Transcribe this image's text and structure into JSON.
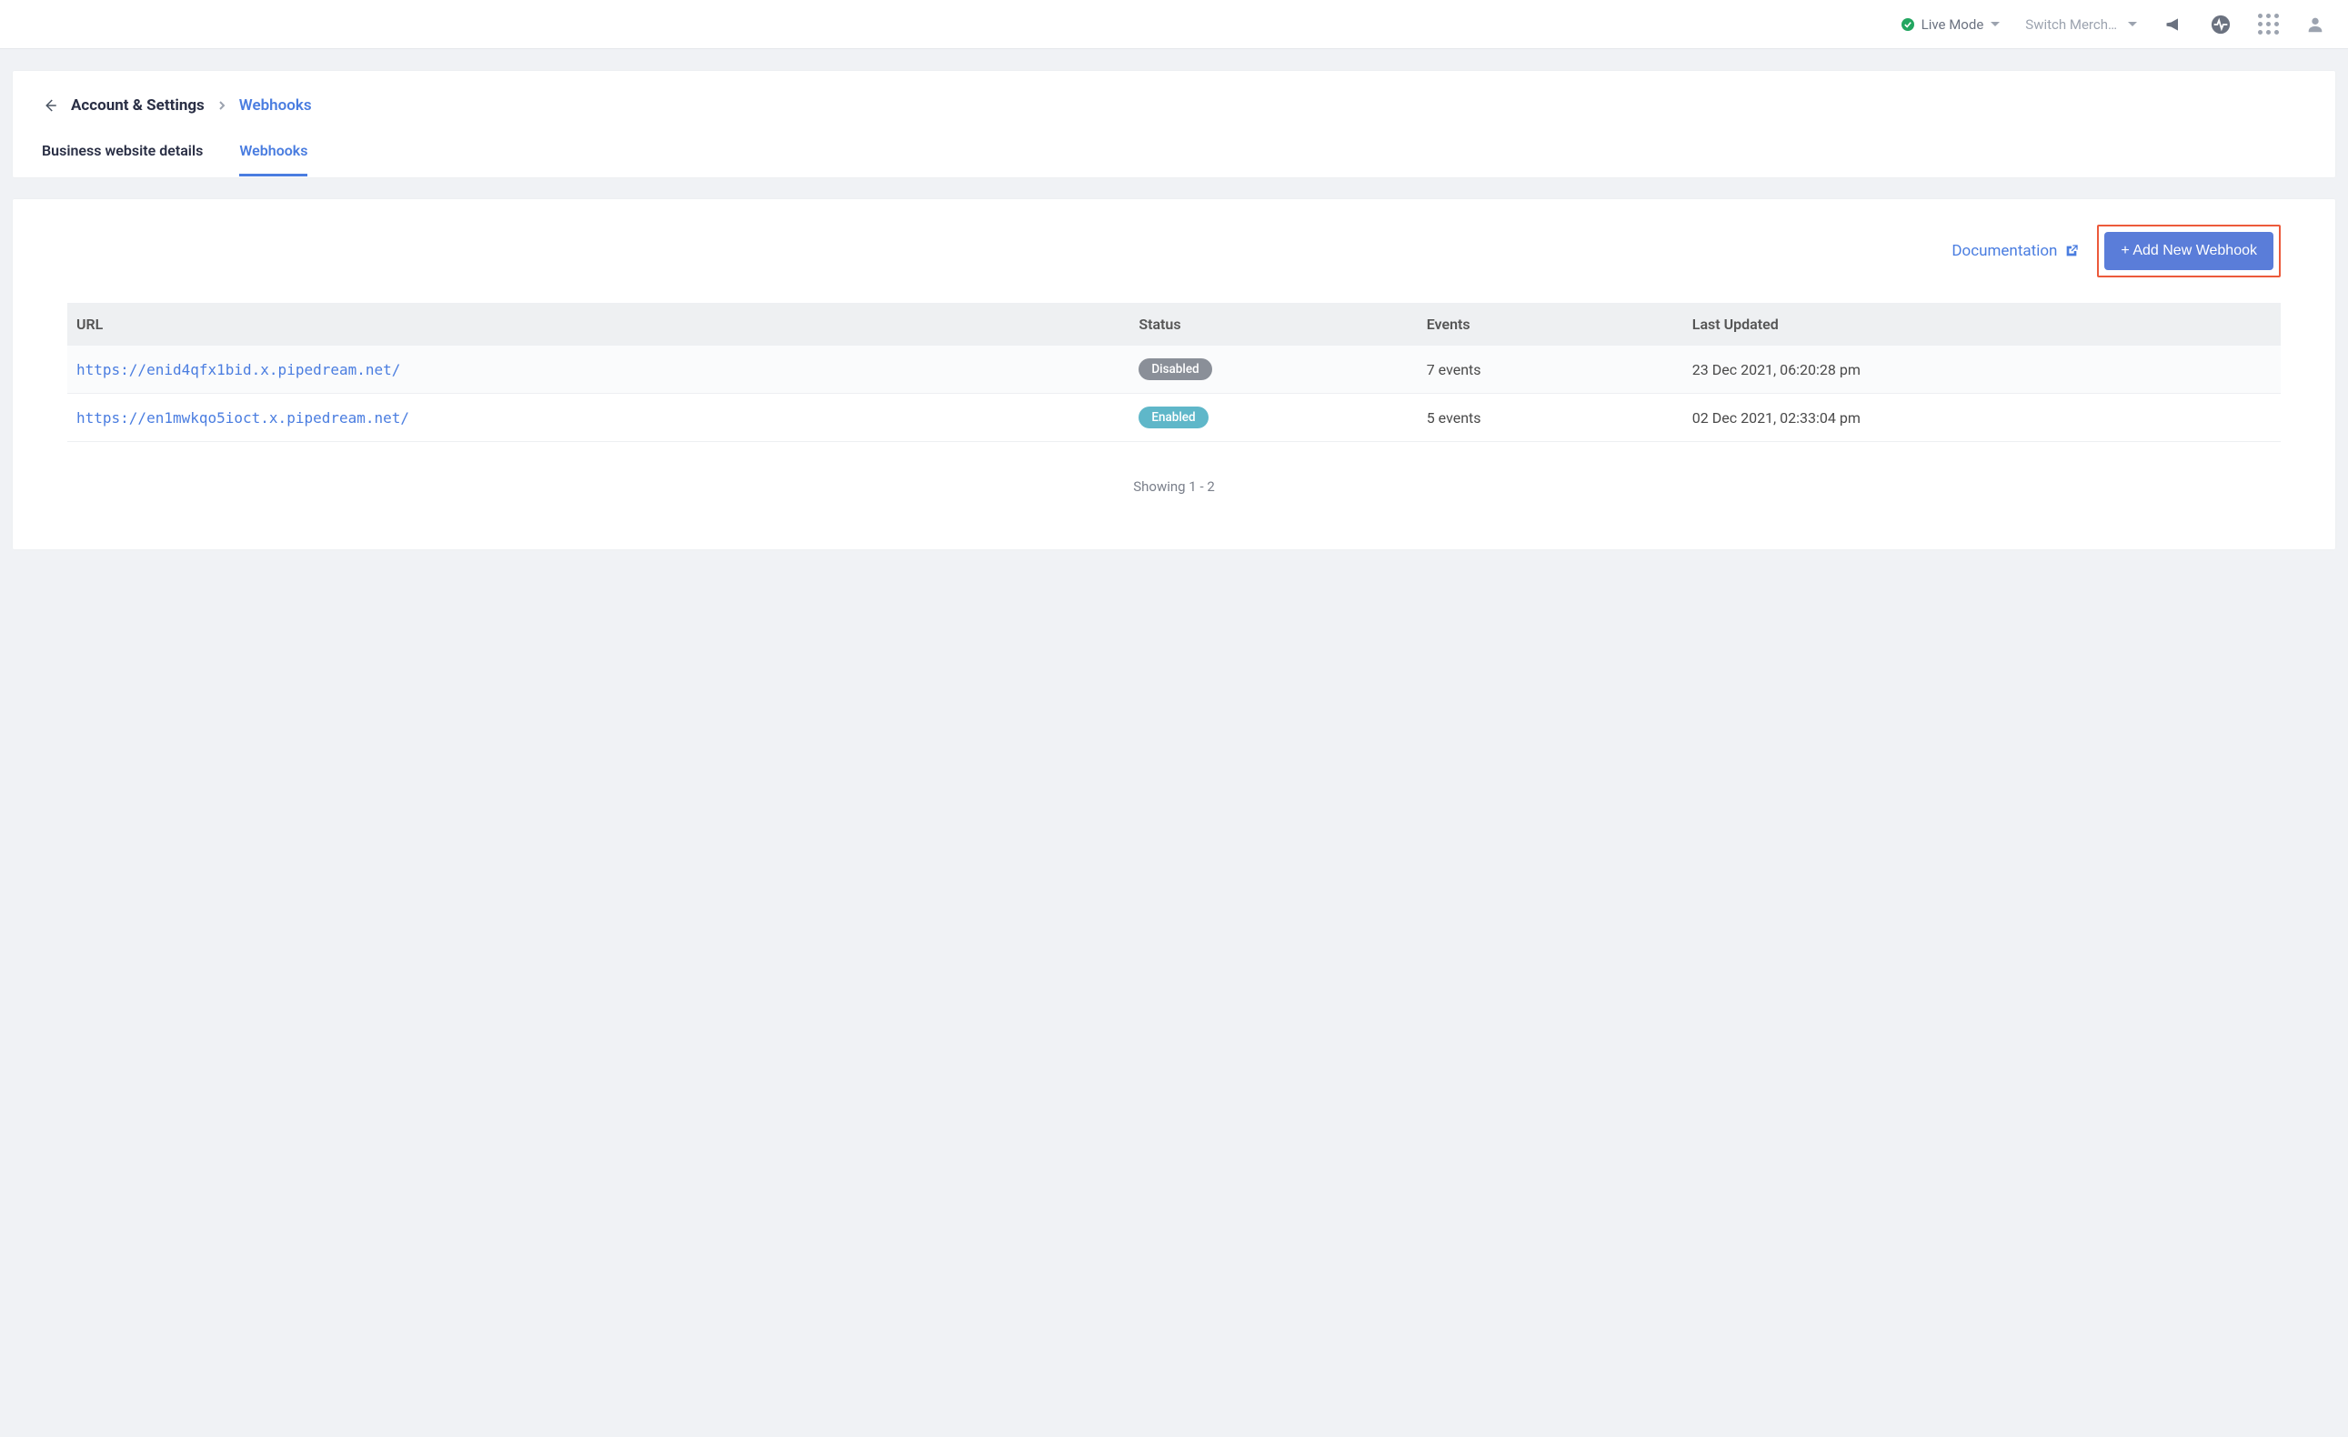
{
  "topbar": {
    "mode_label": "Live Mode",
    "switch_label": "Switch Merch…"
  },
  "breadcrumb": {
    "parent": "Account & Settings",
    "current": "Webhooks"
  },
  "tabs": [
    {
      "label": "Business website details"
    },
    {
      "label": "Webhooks"
    }
  ],
  "actions": {
    "documentation_label": "Documentation",
    "add_webhook_label": "+ Add New Webhook"
  },
  "table": {
    "headers": {
      "url": "URL",
      "status": "Status",
      "events": "Events",
      "updated": "Last Updated"
    },
    "rows": [
      {
        "url": "https://enid4qfx1bid.x.pipedream.net/",
        "status": "Disabled",
        "events": "7 events",
        "updated": "23 Dec 2021, 06:20:28 pm"
      },
      {
        "url": "https://en1mwkqo5ioct.x.pipedream.net/",
        "status": "Enabled",
        "events": "5 events",
        "updated": "02 Dec 2021, 02:33:04 pm"
      }
    ]
  },
  "footer": {
    "showing": "Showing 1 - 2"
  }
}
